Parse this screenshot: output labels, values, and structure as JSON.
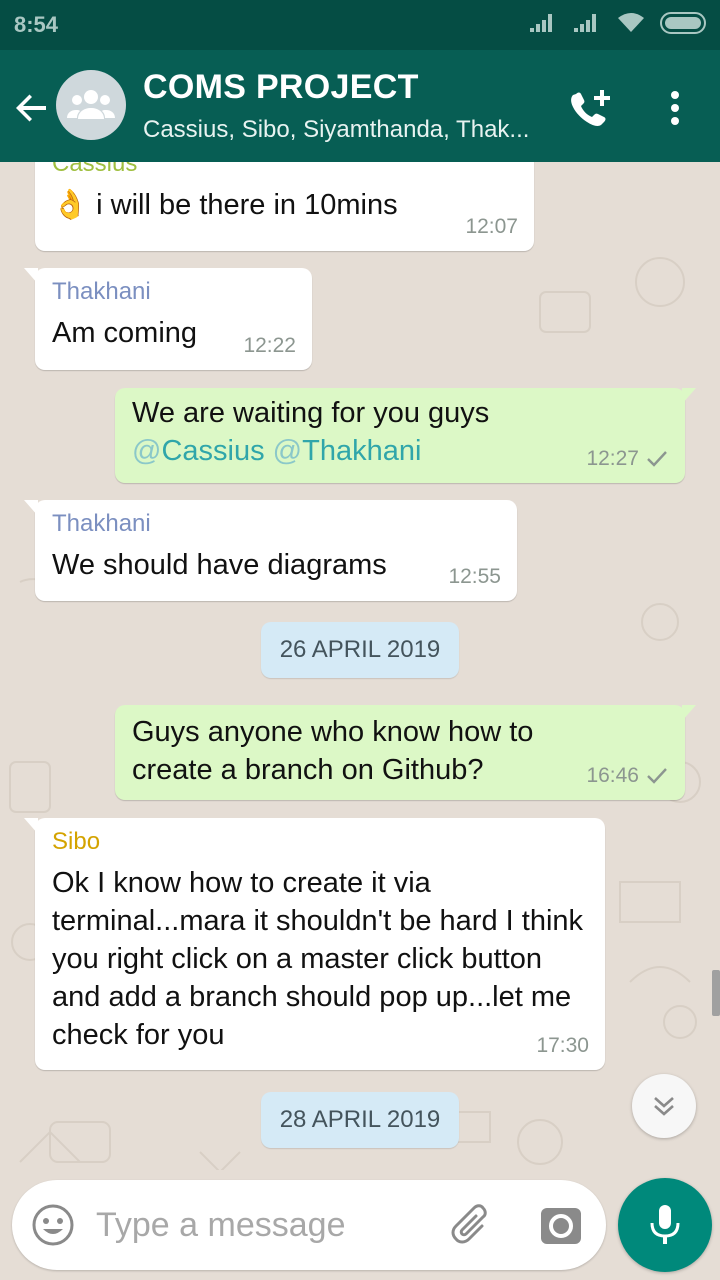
{
  "status_bar": {
    "time": "8:54"
  },
  "header": {
    "title": "COMS PROJECT",
    "members": "Cassius, Sibo, Siyamthanda, Thak..."
  },
  "messages": [
    {
      "sender": "Cassius",
      "text": "i will be there in 10mins",
      "emoji": "👌",
      "time": "12:07"
    },
    {
      "sender": "Thakhani",
      "text": "Am coming",
      "time": "12:22"
    },
    {
      "text_line1": "We are waiting for you guys",
      "mention1": "Cassius",
      "mention2": "Thakhani",
      "at": "@",
      "time": "12:27"
    },
    {
      "sender": "Thakhani",
      "text": "We should have diagrams",
      "time": "12:55"
    },
    {
      "date": "26 APRIL 2019"
    },
    {
      "text": "Guys anyone who know how to create a branch on Github?",
      "time": "16:46"
    },
    {
      "sender": "Sibo",
      "text": "Ok I know how to create it via terminal...mara it shouldn't be hard I think you right click on a master click button and add a branch should pop up...let me check for you",
      "time": "17:30"
    },
    {
      "date": "28 APRIL 2019"
    }
  ],
  "colors": {
    "cassius": "#9fbf3f",
    "thakhani": "#7b8fc0",
    "sibo": "#d4a300",
    "header": "#075e54",
    "outgoing": "#dcf8c6"
  },
  "input": {
    "placeholder": "Type a message"
  },
  "icons": [
    "back-arrow-icon",
    "group-avatar-icon",
    "add-call-icon",
    "more-vert-icon",
    "double-chevron-down-icon",
    "emoji-icon",
    "paperclip-icon",
    "camera-icon",
    "mic-icon"
  ]
}
